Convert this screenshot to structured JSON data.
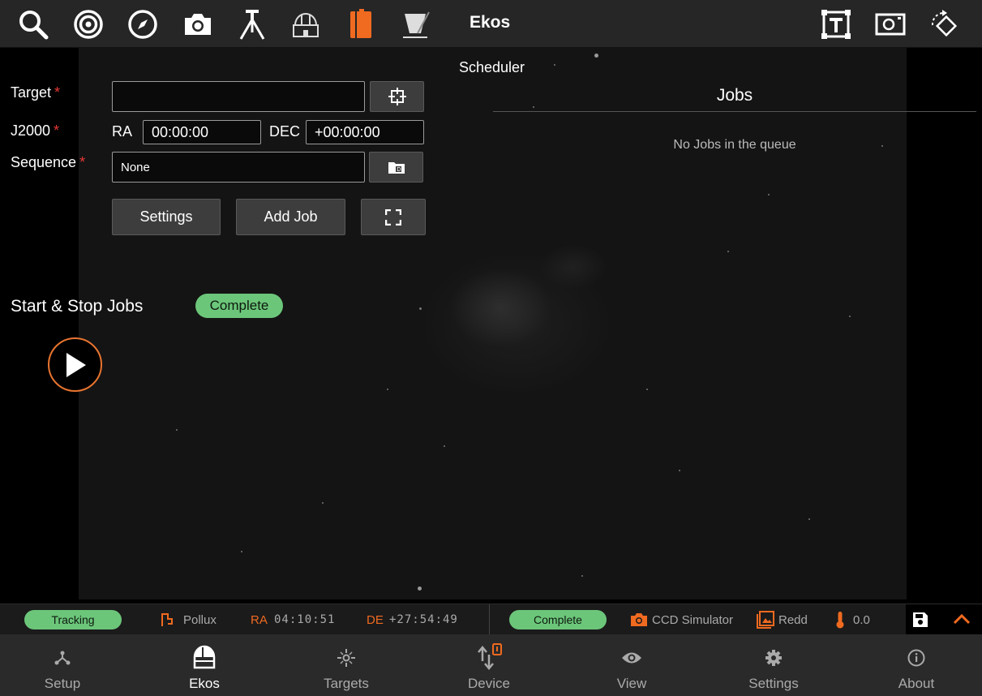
{
  "toolbar": {
    "title": "Ekos",
    "icons": [
      "search-icon",
      "target-icon",
      "compass-icon",
      "camera-icon",
      "tripod-icon",
      "observatory-icon",
      "scheduler-icon",
      "flat-field-icon",
      "text-frame-icon",
      "frame-icon",
      "rotate-icon"
    ],
    "active_color": "#f06a20"
  },
  "scheduler": {
    "title": "Scheduler",
    "target_label": "Target",
    "target_value": "",
    "j2000_label": "J2000",
    "ra_label": "RA",
    "ra_value": "00:00:00",
    "dec_label": "DEC",
    "dec_value": "+00:00:00",
    "sequence_label": "Sequence",
    "sequence_value": "None",
    "required_mark": "*",
    "settings_button": "Settings",
    "add_job_button": "Add Job",
    "start_stop_label": "Start & Stop Jobs",
    "status": "Complete"
  },
  "jobs": {
    "title": "Jobs",
    "empty_text": "No Jobs in the queue"
  },
  "statusbar": {
    "mount_status": "Tracking",
    "target_name": "Pollux",
    "ra_label": "RA",
    "ra_value": "04:10:51",
    "de_label": "DE",
    "de_value": "+27:54:49",
    "scheduler_status": "Complete",
    "camera_name": "CCD Simulator",
    "filter_name": "Redd",
    "temperature": "0.0",
    "status_green": "#6cc67a",
    "accent_orange": "#f06a20"
  },
  "bottomnav": {
    "items": [
      {
        "label": "Setup",
        "icon": "setup-icon"
      },
      {
        "label": "Ekos",
        "icon": "ekos-icon"
      },
      {
        "label": "Targets",
        "icon": "targets-icon"
      },
      {
        "label": "Device",
        "icon": "device-icon"
      },
      {
        "label": "View",
        "icon": "eye-icon"
      },
      {
        "label": "Settings",
        "icon": "gear-icon"
      },
      {
        "label": "About",
        "icon": "info-icon"
      }
    ]
  }
}
